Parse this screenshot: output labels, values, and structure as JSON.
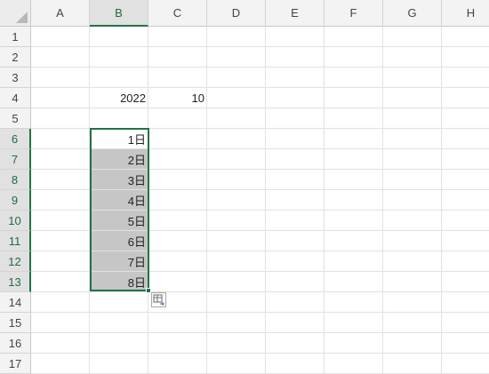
{
  "columns": [
    "A",
    "B",
    "C",
    "D",
    "E",
    "F",
    "G",
    "H"
  ],
  "rows": [
    "1",
    "2",
    "3",
    "4",
    "5",
    "6",
    "7",
    "8",
    "9",
    "10",
    "11",
    "12",
    "13",
    "14",
    "15",
    "16",
    "17"
  ],
  "cells": {
    "B4": "2022",
    "C4": "10",
    "B6": "1日",
    "B7": "2日",
    "B8": "3日",
    "B9": "4日",
    "B10": "5日",
    "B11": "6日",
    "B12": "7日",
    "B13": "8日"
  },
  "selection": {
    "range": "B6:B13",
    "active": "B6"
  },
  "colors": {
    "accent": "#217346",
    "selection_fill": "#c6c6c6"
  },
  "autofill_options_icon": "autofill-options-icon"
}
